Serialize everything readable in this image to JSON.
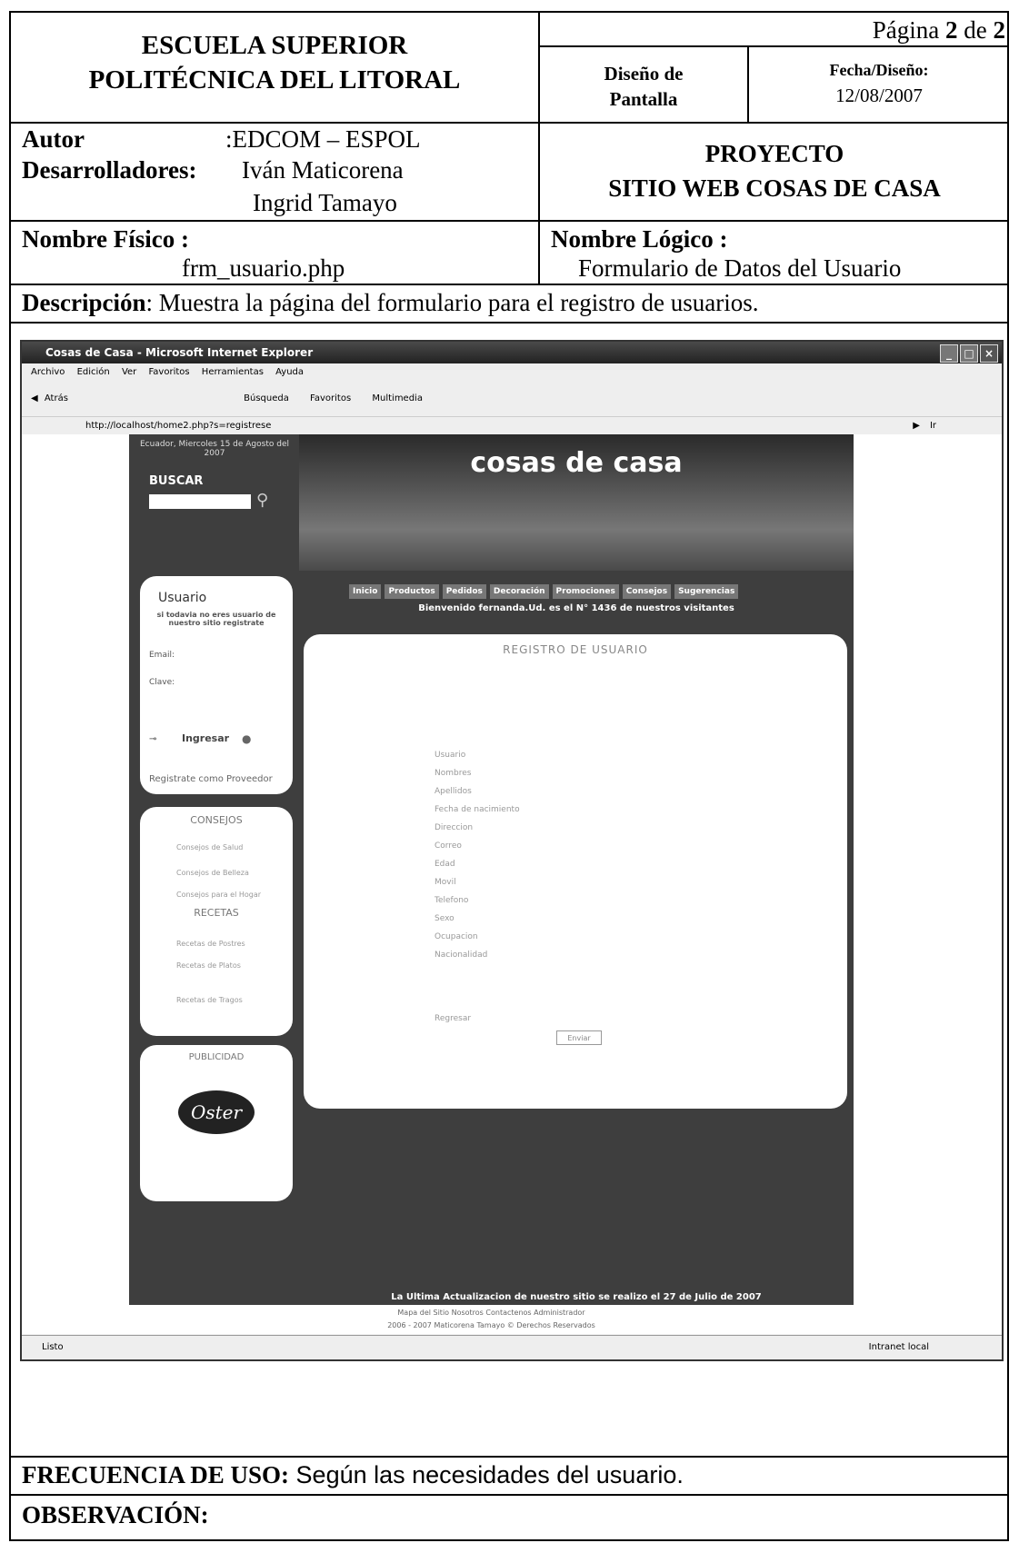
{
  "header": {
    "institution_line1": "ESCUELA SUPERIOR",
    "institution_line2": "POLITÉCNICA DEL LITORAL",
    "page_prefix": "Página ",
    "page_current": "2",
    "page_mid": " de ",
    "page_total": "2",
    "design_label_1": "Diseño de",
    "design_label_2": "Pantalla",
    "date_label": "Fecha/Diseño:",
    "date_value": "12/08/2007"
  },
  "authors": {
    "author_label": "Autor",
    "author_value": ":EDCOM – ESPOL",
    "dev_label": "Desarrolladores:",
    "dev_1": "Iván Maticorena",
    "dev_2": "Ingrid Tamayo"
  },
  "project": {
    "line1": "PROYECTO",
    "line2": "SITIO WEB COSAS DE CASA"
  },
  "names": {
    "physical_label": "Nombre Físico :",
    "physical_value": "frm_usuario.php",
    "logical_label": "Nombre Lógico :",
    "logical_value": "Formulario de Datos del Usuario"
  },
  "description": {
    "label": "Descripción",
    "text": ": Muestra la página del formulario para el registro de usuarios."
  },
  "browser": {
    "title": "Cosas de Casa - Microsoft Internet Explorer",
    "menu": [
      "Archivo",
      "Edición",
      "Ver",
      "Favoritos",
      "Herramientas",
      "Ayuda"
    ],
    "toolbar": [
      "Atrás",
      "Búsqueda",
      "Favoritos",
      "Multimedia"
    ],
    "address": "http://localhost/home2.php?s=registrese",
    "go_label": "Ir",
    "status": "Listo",
    "zone": "Intranet local"
  },
  "site": {
    "date_text": "Ecuador, Miercoles 15 de Agosto del 2007",
    "search_label": "BUSCAR",
    "brand": "cosas de casa",
    "nav": [
      "Inicio",
      "Productos",
      "Pedidos",
      "Decoración",
      "Promociones",
      "Consejos",
      "Sugerencias"
    ],
    "welcome": "Bienvenido fernanda.Ud. es el N° 1436 de nuestros visitantes",
    "login_title": "Usuario",
    "login_note": "si todavia no eres usuario de nuestro sitio registrate",
    "email_label": "Email:",
    "password_label": "Clave:",
    "login_button": "Ingresar",
    "provider_link": "Registrate como Proveedor",
    "tips_title": "CONSEJOS",
    "tips": [
      "Consejos de Salud",
      "Consejos de Belleza",
      "Consejos para el Hogar"
    ],
    "recipes_title": "RECETAS",
    "recipes": [
      "Recetas de Postres",
      "Recetas de Platos",
      "Recetas de Tragos"
    ],
    "ads_title": "PUBLICIDAD",
    "ad_brand": "Oster",
    "form_title": "REGISTRO DE USUARIO",
    "form_fields": [
      "Usuario",
      "Nombres",
      "Apellidos",
      "Fecha de nacimiento",
      "Direccion",
      "Correo",
      "Edad",
      "Movil",
      "Telefono",
      "Sexo",
      "Ocupacion",
      "Nacionalidad"
    ],
    "back_link": "Regresar",
    "submit_button": "Enviar",
    "update_text": "La Ultima Actualizacion de nuestro sitio se realizo el 27 de Julio de 2007",
    "footer_links": "Mapa del Sitio  Nosotros  Contactenos  Administrador",
    "copyright": "2006 - 2007 Maticorena Tamayo ©  Derechos Reservados"
  },
  "usage": {
    "label": "FRECUENCIA DE USO:",
    "text": " Según las necesidades del usuario."
  },
  "observation": {
    "label": "OBSERVACIÓN:"
  }
}
